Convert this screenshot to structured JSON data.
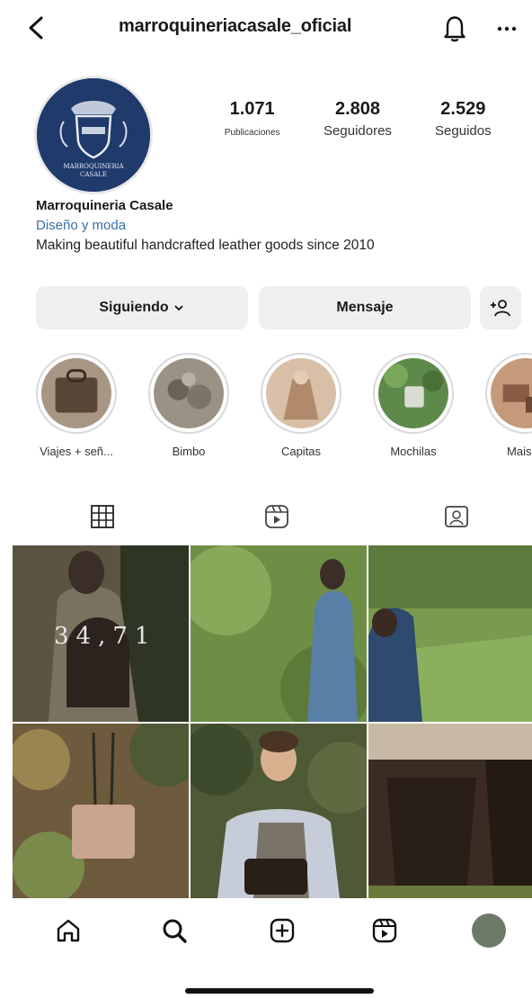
{
  "header": {
    "username": "marroquineriacasale_oficial",
    "back_icon": "chevron-left-icon",
    "bell_icon": "bell-icon",
    "more_icon": "more-horizontal-icon"
  },
  "profile": {
    "avatar_color": "#1f3a6b",
    "logo_text_line1": "MARROQUINERIA",
    "logo_text_line2": "CASALE",
    "stats": [
      {
        "value": "1.071",
        "label": "Publicaciones"
      },
      {
        "value": "2.808",
        "label": "Seguidores"
      },
      {
        "value": "2.529",
        "label": "Seguidos"
      }
    ],
    "name": "Marroquineria Casale",
    "category": "Diseño y moda",
    "bio": "Making beautiful handcrafted leather goods since 2010"
  },
  "actions": {
    "follow_label": "Siguiendo",
    "message_label": "Mensaje",
    "add_user_icon": "add-user-icon"
  },
  "highlights": [
    {
      "label": "Viajes + señ...",
      "color": "#5a4636"
    },
    {
      "label": "Bimbo",
      "color": "#7c7466"
    },
    {
      "label": "Capitas",
      "color": "#b08a6a"
    },
    {
      "label": "Mochilas",
      "color": "#5d8a4a"
    },
    {
      "label": "Maison",
      "color": "#8a5a44"
    }
  ],
  "tabs": [
    {
      "name": "grid-icon"
    },
    {
      "name": "reels-icon"
    },
    {
      "name": "tagged-icon"
    }
  ],
  "posts": [
    {
      "overlay": "34,71",
      "color": "#5b5442"
    },
    {
      "overlay": "",
      "color": "#6e8e46"
    },
    {
      "overlay": "",
      "color": "#7a9a50"
    },
    {
      "overlay": "",
      "color": "#6e5a3c"
    },
    {
      "overlay": "",
      "color": "#4e5a36"
    },
    {
      "overlay": "",
      "color": "#3a2c22"
    }
  ],
  "bottom_nav": [
    {
      "name": "home-icon"
    },
    {
      "name": "search-icon"
    },
    {
      "name": "create-post-icon"
    },
    {
      "name": "reels-nav-icon"
    },
    {
      "name": "profile-avatar"
    }
  ]
}
